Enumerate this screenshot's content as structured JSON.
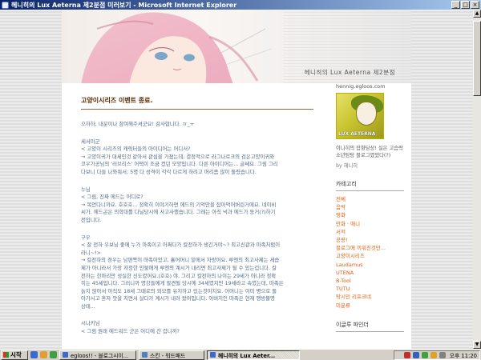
{
  "window": {
    "title": "헤니히의 Lux Aeterna 제2분점 미러보기 - Microsoft Internet Explorer",
    "controls": {
      "minimize": "_",
      "maximize": "□",
      "close": "×"
    }
  },
  "header": {
    "blog_title": "헤니히의 Lux Aeterna 제2분점"
  },
  "post": {
    "title": "고양이시리즈 이벤트 종료.",
    "paragraphs": [
      [
        "으하하; 내분이나 참여해주셔군요! 감사합니다. ㅠ_ㅜ"
      ],
      [
        "세서미군",
        "< 고양이 시리즈의 캐릭터들의 아이디어는 어디서?",
        "→ 고양이귀가 대세인것 같아서 관심을 가졌는데, 결정적으로 라그나로크의 검은고양이귀와",
        "코우가공님의 '러브리스' 어택이 조금 컸던 모양입니다. 다른 아이디어는... 글쎄요. 그림 그리",
        "다보니 다들 나와줘서; 5명 다 성격이 각각 다르게 하려고 머리좀 많이 돌렸습니다."
      ],
      [
        "누님",
        "< 그림, 진짜 에드는 어디로?",
        "→ 목언다니까요. 호호호... 정확히 이야기하면 에드의 기억만을 잡아먹어버린거에요. 네이비",
        "씨가. 에드곤은 의학대를 다닐당시에 사고사했습니다. 그래는 아직 넉과 에드가 동거(?)하기",
        "전입니다."
      ],
      [
        "구우",
        "< 잘 전하 우보님 좋에 누가 마족이고 어쩌다가 칼전하가 생긴거야~? 최고신관과 마족처럼이",
        "라니~!>",
        "→ 칼전하의 경우는 남편쪽이 마족이었고, 흘어머니 밑에서 자랑어요. 루엔의 최고사제는 세습",
        "제가 아니라서 가장 자정한 인물에게 루엔의 계시가 내리면 최고사제가 될 수 있는겁니다. 칼",
        "전하는 한마리만 성실한 신도였어요.(호호) 야, 그리고 칼전하의 나이는 29세가 아니라 정확",
        "히는 45세입니다. 그러니까 명강들에게 발견될 당시에 34세였지만 19세라고 속였는데, 마족은",
        "늙지 않아서 아직도 18세 그때로의 외모를 유지하고 있는것이지요. 어머니는 이미 병으로 돌",
        "아가시고 혼자 맛을 치면서 살다가 계시가 내려 왔어입니다. 아버지인 마족은 현재 행방불명",
        "상태..."
      ],
      [
        "시나키님",
        "< 그림 원래 에드워드 군은 어디에 간 겁니까?"
      ]
    ]
  },
  "sidebar": {
    "url": "hennig.egloos.com",
    "profile_tag": "LUX AETERNA",
    "intro": "이니히의 잡향담상! 실은 고슴락 소년탐탕 블로그였었다(?)",
    "by": "by 헤니히",
    "category_header": "카테고리",
    "categories": [
      "전체",
      "음악",
      "영화",
      "만화 · 애니",
      "서적",
      "공량!",
      "블로그에 끼워진것만...",
      "고양이시리즈",
      "Laudamus",
      "UTENA",
      "B-Tool",
      "TUTU",
      "탁시민 리프크네",
      "미분류"
    ],
    "next_header": "이글루 파인더"
  },
  "taskbar": {
    "start_label": "시작",
    "tasks": [
      {
        "label": "egloos!! - 블로그시이...",
        "active": false
      },
      {
        "label": "스킨 - 워드패드",
        "active": false
      },
      {
        "label": "헤니히의 Lux Aeter...",
        "active": true
      }
    ],
    "clock": "오후 11:20"
  }
}
